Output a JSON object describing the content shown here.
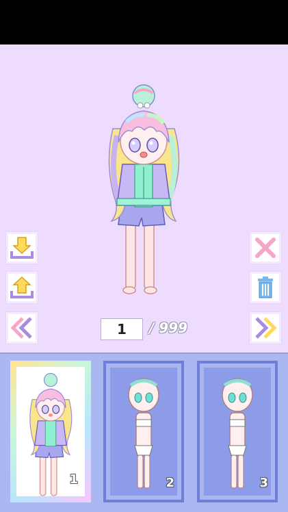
{
  "pager": {
    "current": "1",
    "total": "/ 999"
  },
  "slots": [
    {
      "number": "1",
      "selected": true
    },
    {
      "number": "2",
      "selected": false
    },
    {
      "number": "3",
      "selected": false
    }
  ],
  "icons": {
    "save": "download-icon",
    "load": "upload-icon",
    "prev": "double-chevron-left-icon",
    "close": "close-icon",
    "delete": "trash-icon",
    "next": "double-chevron-right-icon"
  },
  "colors": {
    "stage_bg": "#eedcff",
    "tray_bg": "#a9b8f0",
    "accent_purple": "#a98be0",
    "accent_yellow": "#ffd95a",
    "accent_pink": "#f7a6c8",
    "accent_blue": "#78b6ec"
  }
}
